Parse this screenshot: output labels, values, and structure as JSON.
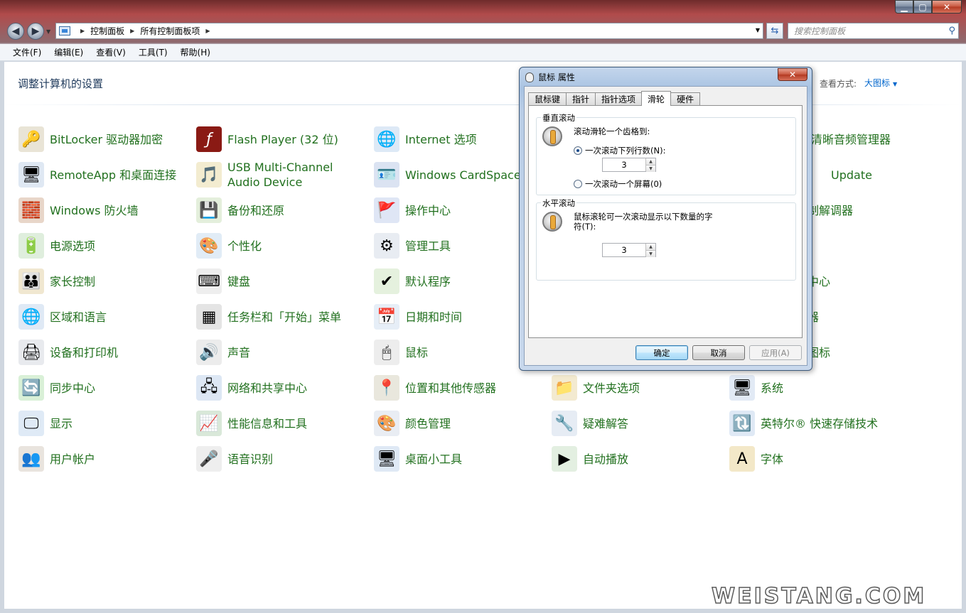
{
  "window": {
    "address": {
      "crumbs": [
        "控制面板",
        "所有控制面板项"
      ]
    },
    "search_placeholder": "搜索控制面板",
    "menus": [
      "文件(F)",
      "编辑(E)",
      "查看(V)",
      "工具(T)",
      "帮助(H)"
    ]
  },
  "content": {
    "heading": "调整计算机的设置",
    "view_by_label": "查看方式:",
    "view_by_value": "大图标",
    "columns": [
      [
        "BitLocker 驱动器加密",
        "RemoteApp 和桌面连接",
        "Windows 防火墙",
        "电源选项",
        "家长控制",
        "区域和语言",
        "设备和打印机",
        "同步中心",
        "显示",
        "用户帐户"
      ],
      [
        "Flash Player (32 位)",
        "USB Multi-Channel Audio Device",
        "备份和还原",
        "个性化",
        "键盘",
        "任务栏和「开始」菜单",
        "声音",
        "网络和共享中心",
        "性能信息和工具",
        "语音识别"
      ],
      [
        "Internet 选项",
        "Windows CardSpace",
        "操作中心",
        "管理工具",
        "默认程序",
        "日期和时间",
        "鼠标",
        "位置和其他传感器",
        "颜色管理",
        "桌面小工具"
      ],
      [
        "",
        "",
        "",
        "",
        "",
        "",
        "",
        "文件夹选项",
        "疑难解答",
        "自动播放"
      ],
      [
        "清晰音频管理器",
        "Update",
        "制解调器",
        "",
        "中心",
        "器",
        "图标",
        "系统",
        "英特尔® 快速存储技术",
        "字体"
      ]
    ],
    "watermark": "WEISTANG.COM"
  },
  "dialog": {
    "title": "鼠标 属性",
    "tabs": [
      "鼠标键",
      "指针",
      "指针选项",
      "滑轮",
      "硬件"
    ],
    "active_tab": "滑轮",
    "vertical": {
      "title": "垂直滚动",
      "prompt": "滚动滑轮一个齿格到:",
      "option_lines": "一次滚动下列行数(N):",
      "lines_value": "3",
      "option_screen": "一次滚动一个屏幕(0)"
    },
    "horizontal": {
      "title": "水平滚动",
      "prompt_line1": "鼠标滚轮可一次滚动显示以下数量的字",
      "prompt_line2": "符(T):",
      "chars_value": "3"
    },
    "buttons": {
      "ok": "确定",
      "cancel": "取消",
      "apply": "应用(A)"
    }
  }
}
